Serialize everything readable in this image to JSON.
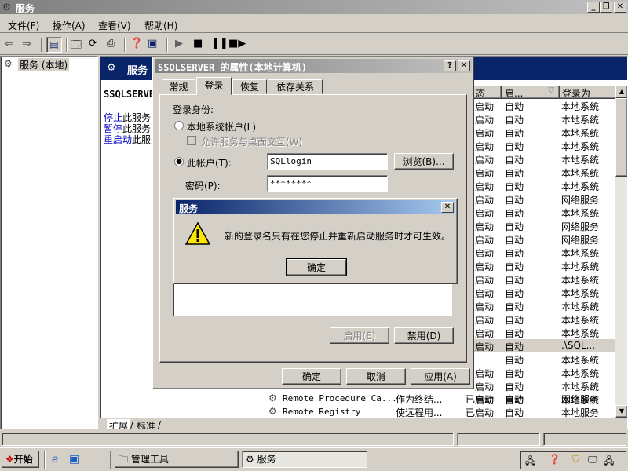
{
  "window": {
    "title": "服务"
  },
  "menu": [
    "文件(F)",
    "操作(A)",
    "查看(V)",
    "帮助(H)"
  ],
  "tree": {
    "root": "服务 (本地)"
  },
  "pane": {
    "header": "服务 (",
    "service_name": "SSQLSERVER",
    "links": [
      {
        "link": "停止",
        "rest": "此服务"
      },
      {
        "link": "暂停",
        "rest": "此服务"
      },
      {
        "link": "重启动",
        "rest": "此服务"
      }
    ]
  },
  "columns": {
    "status": "态",
    "startup": "启...",
    "logon": "登录为"
  },
  "rows": [
    {
      "status": "启动",
      "startup": "自动",
      "logon": "本地系统"
    },
    {
      "status": "启动",
      "startup": "自动",
      "logon": "本地系统"
    },
    {
      "status": "启动",
      "startup": "自动",
      "logon": "本地系统"
    },
    {
      "status": "启动",
      "startup": "自动",
      "logon": "本地系统"
    },
    {
      "status": "启动",
      "startup": "自动",
      "logon": "本地系统"
    },
    {
      "status": "启动",
      "startup": "自动",
      "logon": "本地系统"
    },
    {
      "status": "启动",
      "startup": "自动",
      "logon": "本地系统"
    },
    {
      "status": "启动",
      "startup": "自动",
      "logon": "网络服务"
    },
    {
      "status": "启动",
      "startup": "自动",
      "logon": "本地系统"
    },
    {
      "status": "启动",
      "startup": "自动",
      "logon": "网络服务"
    },
    {
      "status": "启动",
      "startup": "自动",
      "logon": "网络服务"
    },
    {
      "status": "启动",
      "startup": "自动",
      "logon": "本地系统"
    },
    {
      "status": "启动",
      "startup": "自动",
      "logon": "本地系统"
    },
    {
      "status": "启动",
      "startup": "自动",
      "logon": "本地系统"
    },
    {
      "status": "启动",
      "startup": "自动",
      "logon": "本地系统"
    },
    {
      "status": "启动",
      "startup": "自动",
      "logon": "本地系统"
    },
    {
      "status": "启动",
      "startup": "自动",
      "logon": "本地系统"
    },
    {
      "status": "启动",
      "startup": "自动",
      "logon": "本地系统"
    },
    {
      "status": "启动",
      "startup": "自动",
      "logon": ".\\SQL..."
    },
    {
      "status": "",
      "startup": "自动",
      "logon": "本地系统"
    },
    {
      "status": "启动",
      "startup": "自动",
      "logon": "本地系统"
    },
    {
      "status": "启动",
      "startup": "自动",
      "logon": "本地系统"
    },
    {
      "status": "启动",
      "startup": "自动",
      "logon": "本地系统"
    }
  ],
  "bottom_rows": [
    {
      "name": "Remote Procedure Ca...",
      "desc": "作为终结...",
      "status": "已启动",
      "startup": "自动",
      "logon": "网络服务"
    },
    {
      "name": "Remote Registry",
      "desc": "使远程用...",
      "status": "已启动",
      "startup": "自动",
      "logon": "本地服务"
    }
  ],
  "tabs_bottom": [
    "扩展",
    "标准"
  ],
  "props": {
    "title": "SSQLSERVER 的属性(本地计算机)",
    "tabs": [
      "常规",
      "登录",
      "恢复",
      "依存关系"
    ],
    "logon_as": "登录身份:",
    "local_system": "本地系统帐户(L)",
    "allow_desktop": "允许服务与桌面交互(W)",
    "this_account": "此帐户(T):",
    "account_value": "SQLlogin",
    "browse": "浏览(B)...",
    "password_label": "密码(P):",
    "password_value": "********",
    "enable": "启用(E)",
    "disable": "禁用(D)",
    "ok": "确定",
    "cancel": "取消",
    "apply": "应用(A)"
  },
  "msgbox": {
    "title": "服务",
    "message": "新的登录名只有在您停止并重新启动服务时才可生效。",
    "ok": "确定"
  },
  "taskbar": {
    "start": "开始",
    "tasks": [
      "管理工具",
      "服务"
    ]
  }
}
